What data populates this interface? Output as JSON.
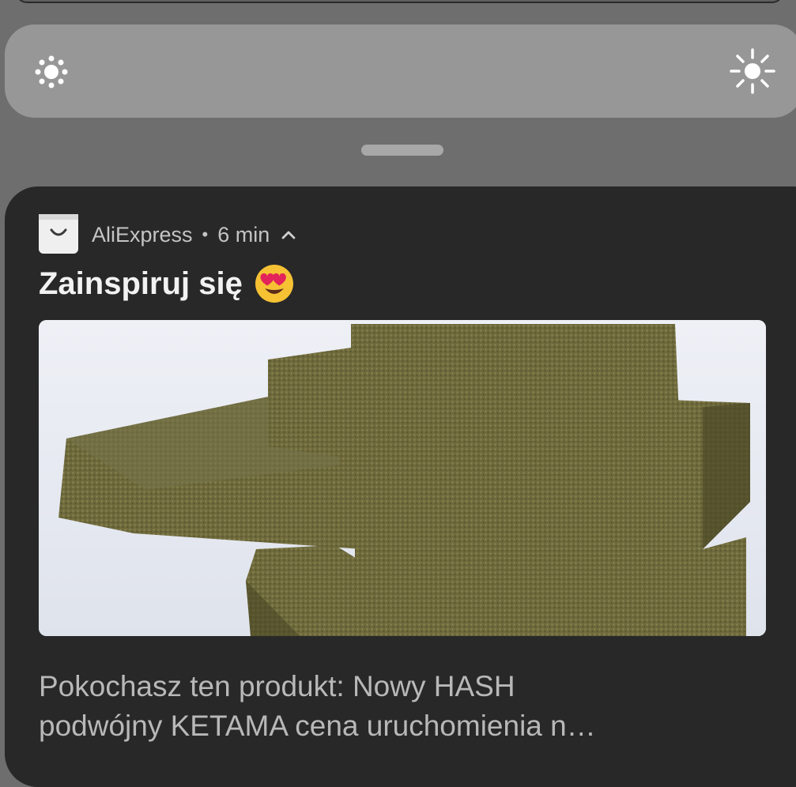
{
  "brightness": {
    "low_icon": "brightness-low-icon",
    "high_icon": "brightness-high-icon"
  },
  "notification": {
    "app_icon": "shopping-bag-icon",
    "app_name": "AliExpress",
    "separator": "•",
    "time": "6 min",
    "expand_icon": "chevron-up-icon",
    "title": "Zainspiruj się",
    "title_emoji": "heart-eyes-emoji",
    "image": "product-photo-green-blocks",
    "body_line1": "Pokochasz ten produkt: Nowy HASH",
    "body_line2": "podwójny KETAMA cena uruchomienia n…"
  },
  "colors": {
    "background": "#6e6e6e",
    "brightness_bar": "#979797",
    "card": "#282828",
    "title_text": "#f2f2f2",
    "meta_text": "#c4c4c4",
    "body_text": "#b8b8b8"
  }
}
